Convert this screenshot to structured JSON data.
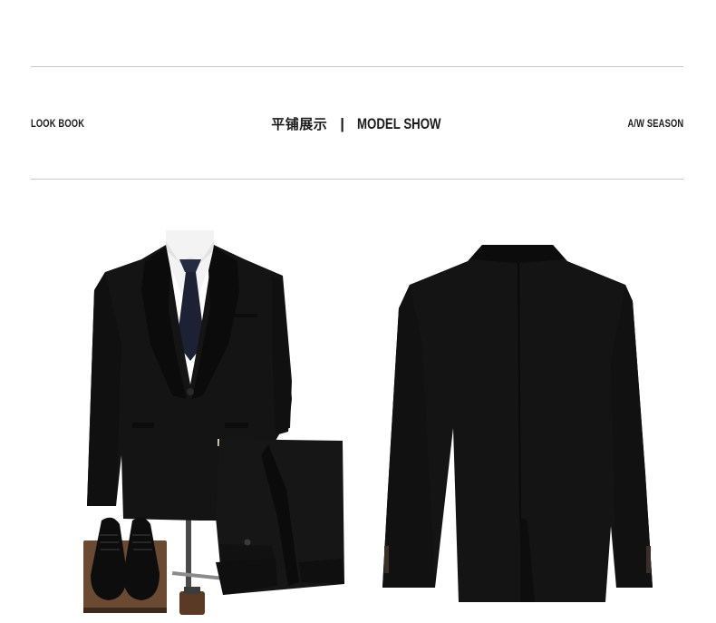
{
  "header": {
    "left_label": "LOOK BOOK",
    "title_cn": "平铺展示",
    "separator": "|",
    "title_en": "MODEL SHOW",
    "right_label": "A/W SEASON"
  },
  "colors": {
    "background": "#ffffff",
    "rule": "#c9c9c9",
    "text": "#1a1a1a",
    "suit": "#141414",
    "tie": "#1c2233",
    "shirt": "#f3f3f3",
    "wood_stand": "#6b4a33"
  }
}
